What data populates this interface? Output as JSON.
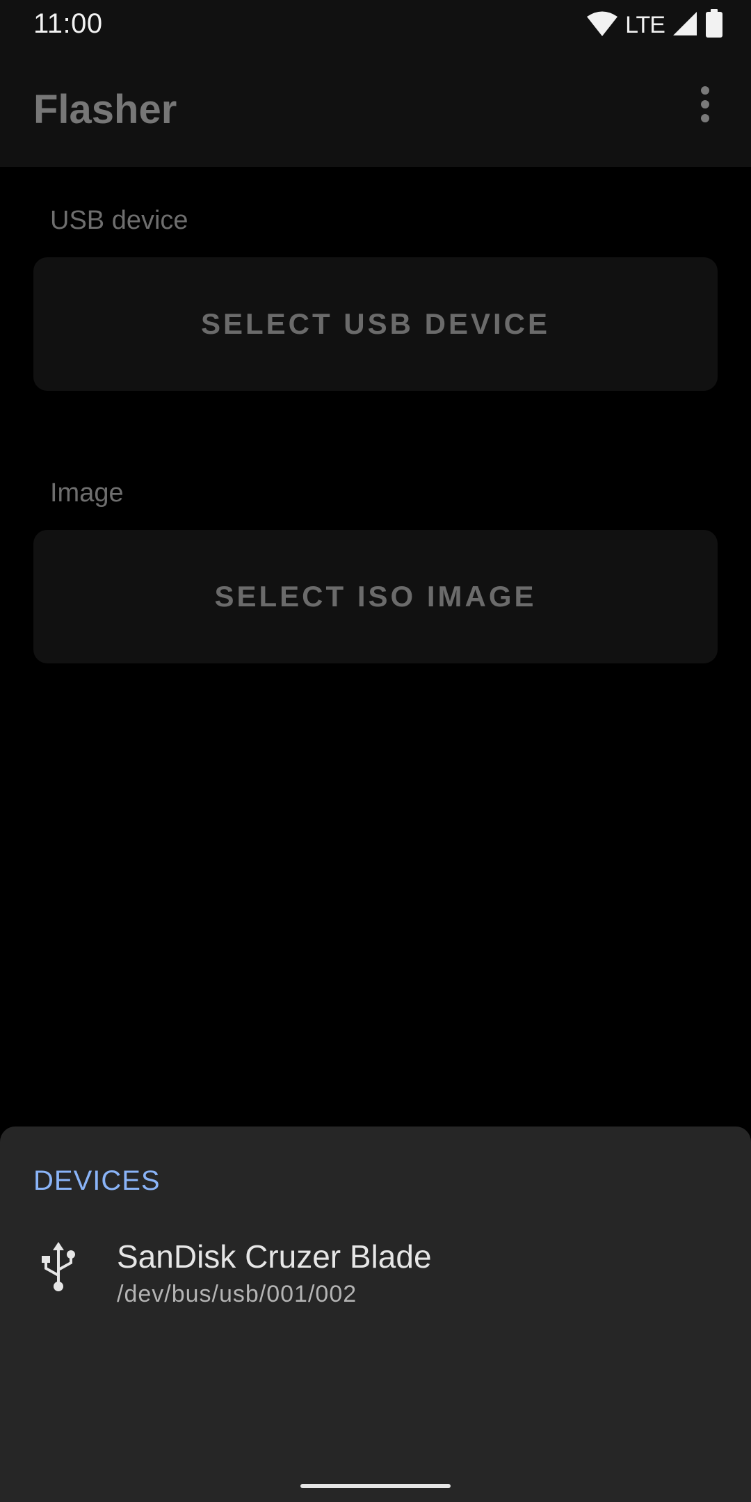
{
  "status_bar": {
    "time": "11:00",
    "network": "LTE",
    "icons": [
      "wifi-icon",
      "signal-icon",
      "battery-icon"
    ]
  },
  "app_bar": {
    "title": "Flasher",
    "overflow_icon": "more-vert-icon"
  },
  "usb_section": {
    "label": "USB device",
    "button_label": "SELECT USB DEVICE"
  },
  "image_section": {
    "label": "Image",
    "button_label": "SELECT ISO IMAGE"
  },
  "sheet": {
    "header": "DEVICES",
    "devices": [
      {
        "icon": "usb-icon",
        "name": "SanDisk Cruzer Blade",
        "path": "/dev/bus/usb/001/002"
      }
    ]
  },
  "colors": {
    "accent": "#8ab4f8",
    "sheet_background": "#262626",
    "app_bar_background": "#111111"
  }
}
